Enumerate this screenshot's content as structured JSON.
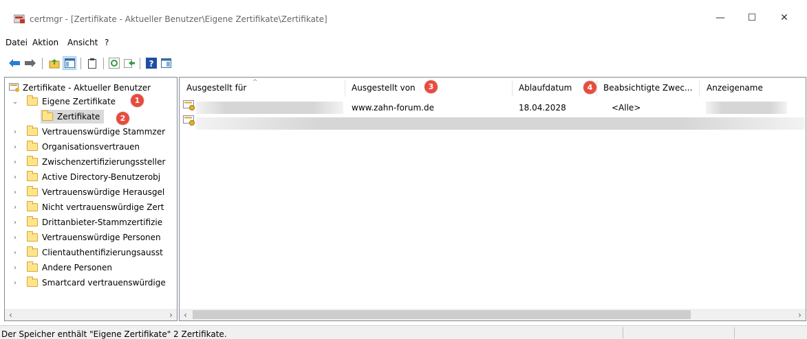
{
  "window": {
    "title": "certmgr - [Zertifikate - Aktueller Benutzer\\Eigene Zertifikate\\Zertifikate]",
    "minimize": "—",
    "maximize": "☐",
    "close": "✕"
  },
  "menu": {
    "items": [
      "Datei",
      "Aktion",
      "Ansicht",
      "?"
    ]
  },
  "toolbar": {
    "icons": [
      "back-arrow-icon",
      "forward-arrow-icon",
      "up-folder-icon",
      "show-hide-console-tree-icon",
      "clipboard-icon",
      "refresh-icon",
      "export-list-icon",
      "help-icon",
      "console-view-icon"
    ]
  },
  "tree": {
    "root": "Zertifikate - Aktueller Benutzer",
    "nodes": [
      {
        "label": "Eigene Zertifikate",
        "expanded": true
      },
      {
        "label": "Zertifikate",
        "selected": true
      },
      {
        "label": "Vertrauenswürdige Stammzer"
      },
      {
        "label": "Organisationsvertrauen"
      },
      {
        "label": "Zwischenzertifizierungssteller"
      },
      {
        "label": "Active Directory-Benutzerobj"
      },
      {
        "label": "Vertrauenswürdige Herausgel"
      },
      {
        "label": "Nicht vertrauenswürdige Zert"
      },
      {
        "label": "Drittanbieter-Stammzertifizie"
      },
      {
        "label": "Vertrauenswürdige Personen"
      },
      {
        "label": "Clientauthentifizierungsausst"
      },
      {
        "label": "Andere Personen"
      },
      {
        "label": "Smartcard vertrauenswürdige"
      }
    ]
  },
  "badges": [
    "1",
    "2",
    "3",
    "4"
  ],
  "list": {
    "columns": [
      "Ausgestellt für",
      "Ausgestellt von",
      "Ablaufdatum",
      "Beabsichtigte Zwec...",
      "Anzeigename"
    ],
    "rows": [
      {
        "issued_to": "",
        "issued_by": "www.zahn-forum.de",
        "expires": "18.04.2028",
        "purposes": "<Alle>",
        "friendly_name": ""
      },
      {
        "issued_to": "",
        "issued_by": "",
        "expires": "",
        "purposes": "",
        "friendly_name": ""
      }
    ]
  },
  "scroll": {
    "left_arrow": "‹",
    "right_arrow": "›"
  },
  "status": {
    "text": "Der Speicher enthält \"Eigene Zertifikate\" 2 Zertifikate."
  }
}
